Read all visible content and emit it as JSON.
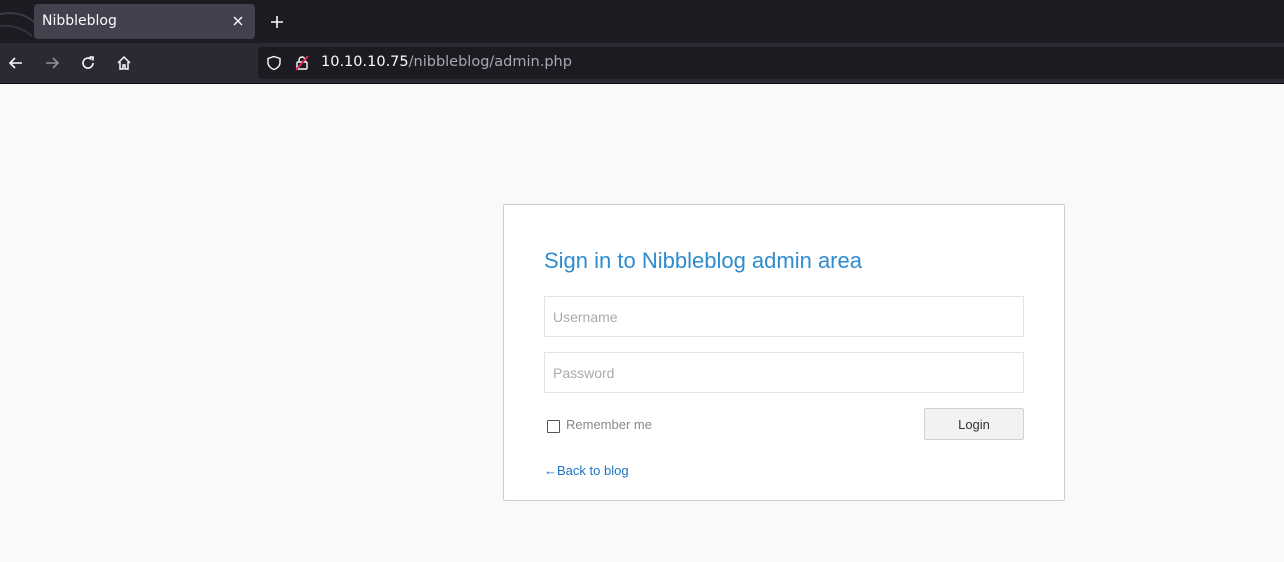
{
  "browser": {
    "tab": {
      "title": "Nibbleblog"
    },
    "url": {
      "host": "10.10.10.75",
      "path": "/nibbleblog/admin.php"
    }
  },
  "login": {
    "title": "Sign in to Nibbleblog admin area",
    "username": {
      "placeholder": "Username",
      "value": ""
    },
    "password": {
      "placeholder": "Password",
      "value": ""
    },
    "remember_label": "Remember me",
    "remember_checked": false,
    "login_label": "Login",
    "back_link": "←Back to blog"
  },
  "colors": {
    "title": "#2e8ccf",
    "link": "#1f72c4",
    "chrome_dark": "#1c1b22",
    "chrome_bar": "#2b2a33"
  },
  "icons": {
    "back": "arrow-left-icon",
    "forward": "arrow-right-icon",
    "reload": "reload-icon",
    "home": "home-icon",
    "shield": "shield-icon",
    "lock": "insecure-lock-icon",
    "close": "close-icon",
    "new_tab": "plus-icon"
  }
}
